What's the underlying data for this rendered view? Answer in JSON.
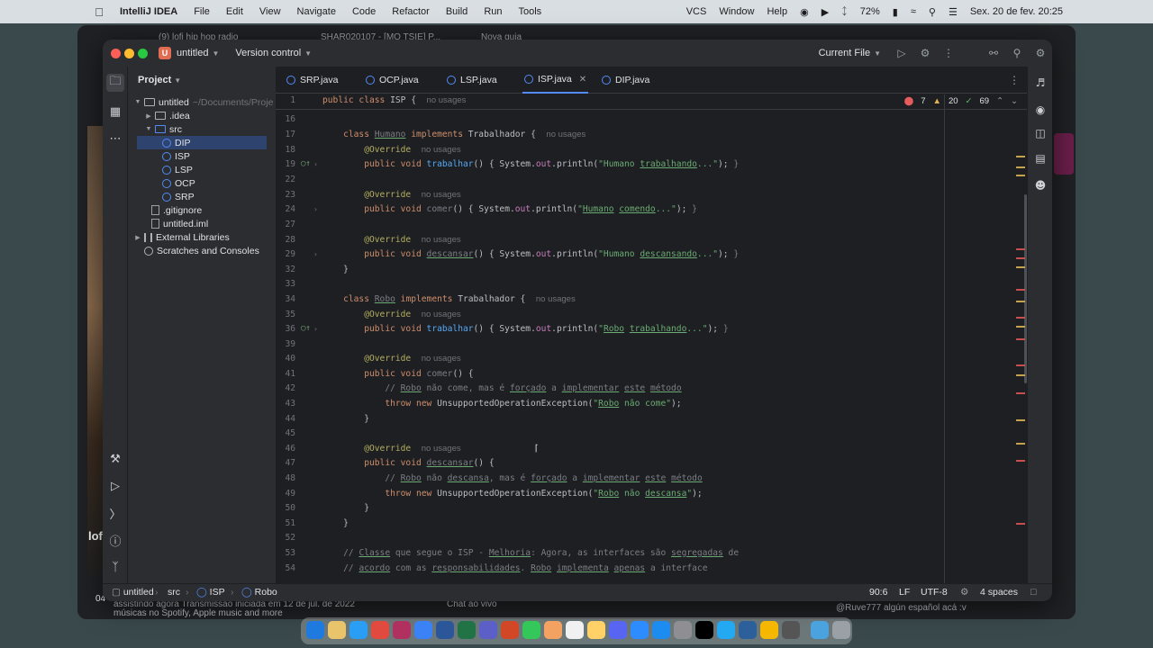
{
  "menubar": {
    "app_name": "IntelliJ IDEA",
    "menus": [
      "File",
      "Edit",
      "View",
      "Navigate",
      "Code",
      "Refactor",
      "Build",
      "Run",
      "Tools"
    ],
    "window_menus": [
      "VCS",
      "Window",
      "Help"
    ],
    "battery": "72%",
    "datetime": "Sex. 20 de fev.  20:25"
  },
  "background": {
    "tab1": "(9) lofi hip hop radio",
    "tab2": "SHAR020107 - [MO TSIE] P...",
    "tab3": "Nova guia",
    "bottom_left": "assistindo agora  Transmissão iniciada em 12 de jul. de 2022",
    "bottom_left2": "músicas no Spotify, Apple music and more",
    "chat_label": "Chat ao vivo",
    "chat_message": "@Ruve777  algún español acá :v",
    "left_text": "lof",
    "left_num": "04"
  },
  "titlebar": {
    "project_initial": "U",
    "project_name": "untitled",
    "vcs_label": "Version control",
    "run_config": "Current File"
  },
  "project_panel": {
    "title": "Project",
    "root": "untitled",
    "root_path": "~/Documents/Proje",
    "items": {
      "idea": ".idea",
      "src": "src",
      "dip": "DIP",
      "isp": "ISP",
      "lsp": "LSP",
      "ocp": "OCP",
      "srp": "SRP",
      "gitignore": ".gitignore",
      "iml": "untitled.iml",
      "ext": "External Libraries",
      "scratch": "Scratches and Consoles"
    }
  },
  "tabs": {
    "srp": "SRP.java",
    "ocp": "OCP.java",
    "lsp": "LSP.java",
    "isp": "ISP.java",
    "dip": "DIP.java"
  },
  "inspections": {
    "errors": "7",
    "warnings": "20",
    "ok": "69"
  },
  "code": {
    "sticky_ln": "1",
    "no_usages": "no usages",
    "l16": "16",
    "l17": "17",
    "l18": "18",
    "l19": "19",
    "l22": "22",
    "l23": "23",
    "l24": "24",
    "l27": "27",
    "l28": "28",
    "l29": "29",
    "l32": "32",
    "l33": "33",
    "l34": "34",
    "l35": "35",
    "l36": "36",
    "l39": "39",
    "l40": "40",
    "l41": "41",
    "l42": "42",
    "l43": "43",
    "l44": "44",
    "l45": "45",
    "l46": "46",
    "l47": "47",
    "l48": "48",
    "l49": "49",
    "l50": "50",
    "l51": "51",
    "l52": "52",
    "l53": "53",
    "l54": "54"
  },
  "statusbar": {
    "crumb1": "untitled",
    "crumb2": "src",
    "crumb3": "ISP",
    "crumb4": "Robo",
    "position": "90:6",
    "line_sep": "LF",
    "encoding": "UTF-8",
    "indent": "4 spaces"
  },
  "colors": {
    "keyword": "#cf8e6d",
    "string": "#6aab73",
    "method": "#56a8f5",
    "annotation": "#b3ae60",
    "comment": "#7a7e85",
    "accent": "#548af7"
  }
}
